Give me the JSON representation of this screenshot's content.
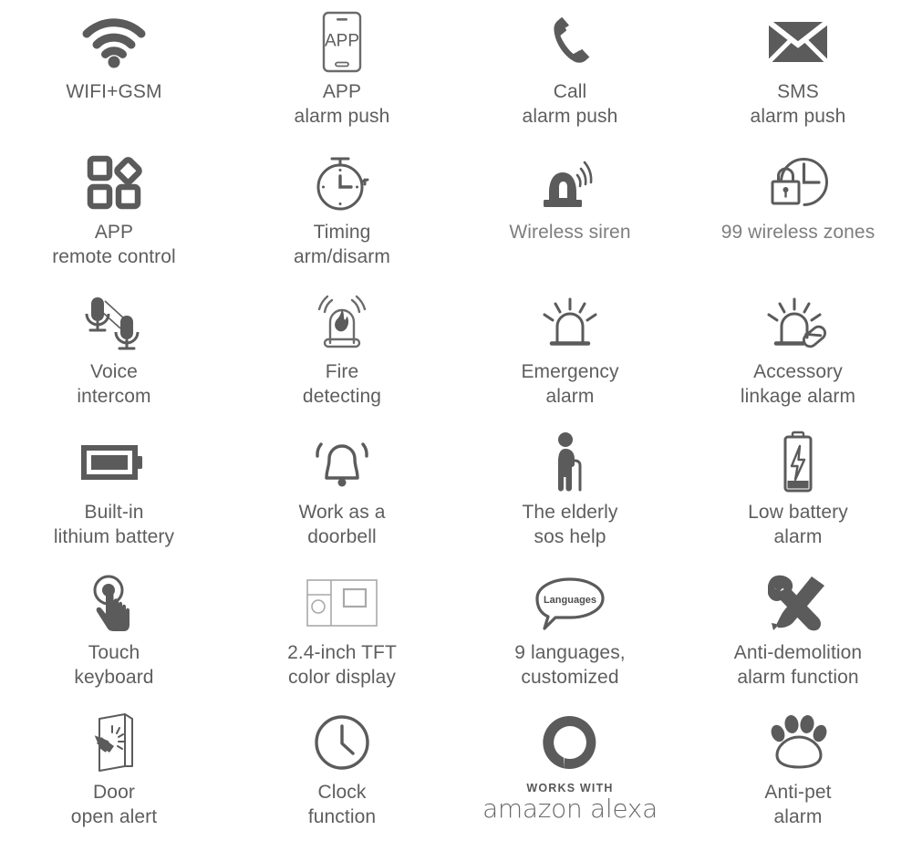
{
  "page": {
    "title": "Alarm system feature icon grid",
    "background_color": "#ffffff",
    "icon_color": "#5b5b5b",
    "text_color": "#5e5e5e",
    "light_text_color": "#7e7e7e",
    "columns": 4,
    "rows": 6
  },
  "features": [
    {
      "icon": "wifi-icon",
      "label": "WIFI+GSM"
    },
    {
      "icon": "app-phone-icon",
      "label": "APP\nalarm push",
      "icon_text": "APP"
    },
    {
      "icon": "phone-handset-icon",
      "label": "Call\nalarm push"
    },
    {
      "icon": "envelope-icon",
      "label": "SMS\nalarm push"
    },
    {
      "icon": "app-tiles-icon",
      "label": "APP\nremote control"
    },
    {
      "icon": "stopwatch-icon",
      "label": "Timing\narm/disarm"
    },
    {
      "icon": "siren-wireless-icon",
      "label": "Wireless siren",
      "light": true
    },
    {
      "icon": "lock-clock-icon",
      "label": "99 wireless zones",
      "light": true
    },
    {
      "icon": "two-microphones-icon",
      "label": "Voice\nintercom"
    },
    {
      "icon": "fire-detector-icon",
      "label": "Fire\ndetecting"
    },
    {
      "icon": "emergency-beacon-icon",
      "label": "Emergency\nalarm"
    },
    {
      "icon": "accessory-linkage-icon",
      "label": "Accessory\nlinkage alarm"
    },
    {
      "icon": "battery-full-icon",
      "label": "Built-in\nlithium battery"
    },
    {
      "icon": "doorbell-icon",
      "label": "Work as a\ndoorbell"
    },
    {
      "icon": "elderly-person-icon",
      "label": "The elderly\nsos help"
    },
    {
      "icon": "battery-low-icon",
      "label": "Low battery\nalarm"
    },
    {
      "icon": "touch-hand-icon",
      "label": "Touch\nkeyboard"
    },
    {
      "icon": "tft-display-icon",
      "label": "2.4-inch TFT\ncolor display"
    },
    {
      "icon": "speech-bubble-icon",
      "label": "9 languages,\ncustomized",
      "icon_text": "Languages"
    },
    {
      "icon": "wrench-screwdriver-icon",
      "label": "Anti-demolition\nalarm function"
    },
    {
      "icon": "door-open-alert-icon",
      "label": "Door\nopen alert"
    },
    {
      "icon": "clock-icon",
      "label": "Clock\nfunction"
    },
    {
      "icon": "amazon-alexa-icon",
      "label": "",
      "wordmark_top": "WORKS WITH",
      "wordmark_main": "amazon alexa"
    },
    {
      "icon": "paw-print-icon",
      "label": "Anti-pet\nalarm"
    }
  ]
}
